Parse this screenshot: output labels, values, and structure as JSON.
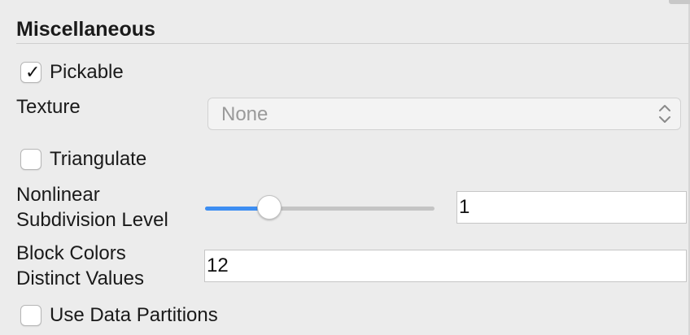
{
  "section": {
    "title": "Miscellaneous"
  },
  "pickable": {
    "label": "Pickable",
    "checked": true,
    "check_glyph": "✓"
  },
  "texture": {
    "label": "Texture",
    "value": "None"
  },
  "triangulate": {
    "label": "Triangulate",
    "checked": false
  },
  "nonlinear_subdivision": {
    "label_line1": "Nonlinear",
    "label_line2": "Subdivision Level",
    "slider_fraction": 0.28,
    "value": "1"
  },
  "block_colors": {
    "label_line1": "Block Colors",
    "label_line2": "Distinct Values",
    "value": "12"
  },
  "use_data_partitions": {
    "label": "Use Data Partitions",
    "checked": false
  },
  "colors": {
    "accent": "#3d8ef2",
    "panel_bg": "#ececec"
  }
}
